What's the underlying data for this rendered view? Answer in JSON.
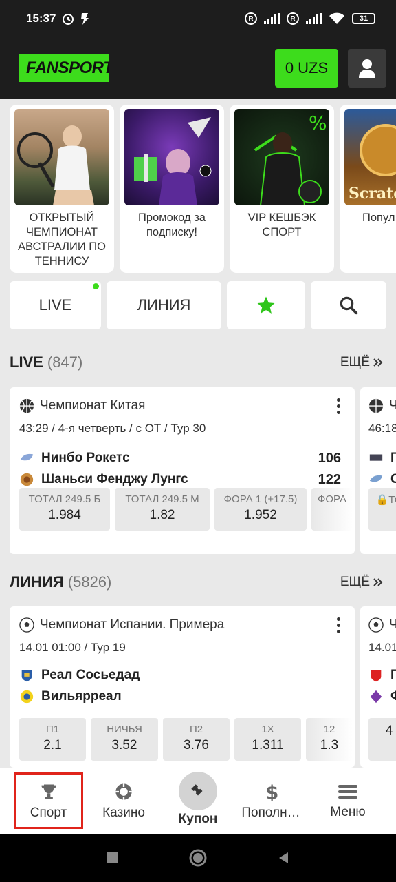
{
  "status_bar": {
    "time": "15:37",
    "battery": "31"
  },
  "header": {
    "logo_text": "FANSPORT",
    "balance": "0 UZS"
  },
  "promos": [
    {
      "caption": "ОТКРЫТЫЙ ЧЕМПИОНАТ АВСТРАЛИИ ПО ТЕННИСУ"
    },
    {
      "caption": "Промокод за подписку!"
    },
    {
      "caption": "VIP КЕШБЭК СПОРТ"
    },
    {
      "caption": "Попул ветр"
    }
  ],
  "promo_art": {
    "scratch_text": "Scratch"
  },
  "tabs": {
    "live": "LIVE",
    "line": "ЛИНИЯ"
  },
  "live_section": {
    "title": "LIVE",
    "count": "(847)",
    "more": "ЕЩЁ",
    "card": {
      "league": "Чемпионат Китая",
      "sub": "43:29 / 4-я четверть / с ОТ / Тур 30",
      "team1": "Нинбо Рокетс",
      "score1": "106",
      "team2": "Шаньси Фенджу Лунгс",
      "score2": "122",
      "odds": [
        {
          "label": "ТОТАЛ 249.5 Б",
          "value": "1.984"
        },
        {
          "label": "ТОТАЛ 249.5 М",
          "value": "1.82"
        },
        {
          "label": "ФОРА 1 (+17.5)",
          "value": "1.952"
        },
        {
          "label": "ФОРА",
          "value": ""
        }
      ]
    },
    "peek": {
      "league": "Ч",
      "sub": "46:18",
      "team1": "Г",
      "team2": "С",
      "odd_label": "ТО"
    }
  },
  "line_section": {
    "title": "ЛИНИЯ",
    "count": "(5826)",
    "more": "ЕЩЁ",
    "card": {
      "league": "Чемпионат Испании. Примера",
      "sub": "14.01 01:00 / Тур 19",
      "team1": "Реал Сосьедад",
      "team2": "Вильярреал",
      "odds": [
        {
          "label": "П1",
          "value": "2.1"
        },
        {
          "label": "НИЧЬЯ",
          "value": "3.52"
        },
        {
          "label": "П2",
          "value": "3.76"
        },
        {
          "label": "1X",
          "value": "1.311"
        },
        {
          "label": "12",
          "value": "1.3"
        }
      ]
    },
    "peek": {
      "league": "Ч",
      "sub": "14.01",
      "team1": "П",
      "team2": "Ф",
      "odd_value": "4"
    }
  },
  "bottom_nav": {
    "sport": "Спорт",
    "casino": "Казино",
    "coupon": "Купон",
    "deposit": "Пополн…",
    "menu": "Меню"
  },
  "colors": {
    "accent": "#3ddc1c",
    "dark": "#1d1d1d",
    "highlight": "#e0241b"
  }
}
